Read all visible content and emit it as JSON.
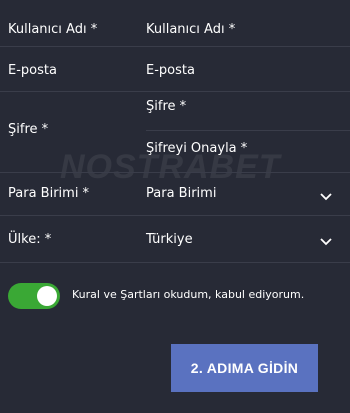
{
  "watermark": "NOSTRABET",
  "form": {
    "username": {
      "label": "Kullanıcı Adı *",
      "placeholder": "Kullanıcı Adı *"
    },
    "email": {
      "label": "E-posta",
      "placeholder": "E-posta"
    },
    "password": {
      "label": "Şifre *",
      "placeholder": "Şifre *",
      "confirm_placeholder": "Şifreyi Onayla *"
    },
    "currency": {
      "label": "Para Birimi *",
      "value": "Para Birimi"
    },
    "country": {
      "label": "Ülke: *",
      "value": "Türkiye"
    }
  },
  "terms": {
    "checked": true,
    "text": "Kural ve Şartları okudum, kabul ediyorum."
  },
  "next_button": {
    "label": "2. ADIMA GİDİN"
  },
  "colors": {
    "background": "#272a36",
    "toggle_on": "#3aa835",
    "button": "#5a72c0",
    "divider": "#3a3d4a"
  },
  "icons": {
    "dropdown": "chevron-down-icon"
  }
}
